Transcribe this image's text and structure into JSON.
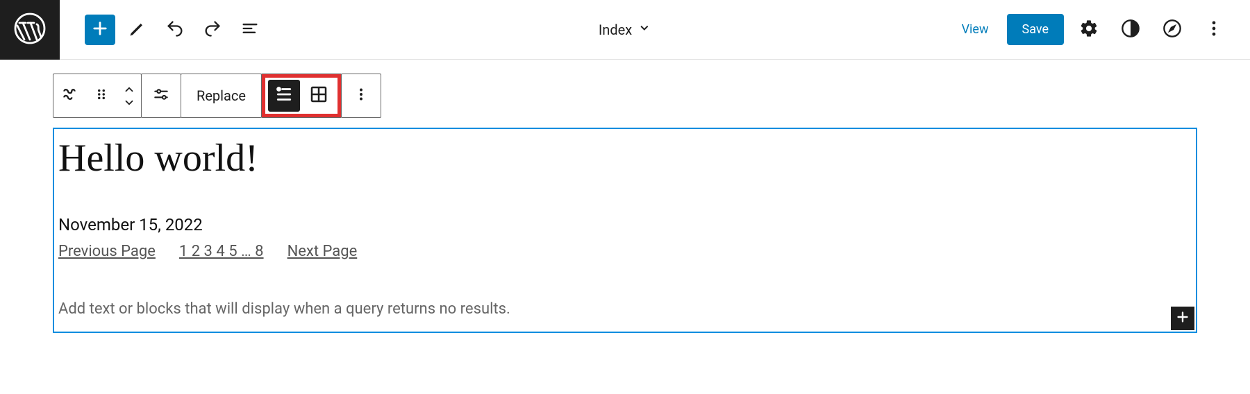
{
  "header": {
    "document_title": "Index",
    "view_label": "View",
    "save_label": "Save"
  },
  "block_toolbar": {
    "replace_label": "Replace"
  },
  "content": {
    "post_title": "Hello world!",
    "post_date": "November 15, 2022",
    "pagination": {
      "prev": "Previous Page",
      "pages": "1 2 3 4 5 … 8",
      "next": "Next Page"
    },
    "no_results_placeholder": "Add text or blocks that will display when a query returns no results."
  }
}
